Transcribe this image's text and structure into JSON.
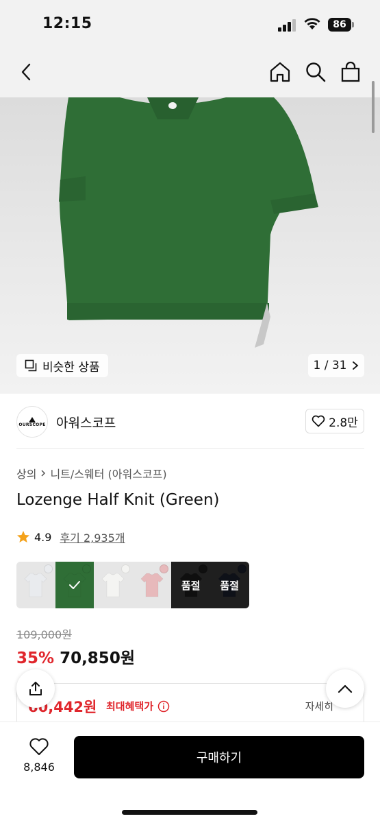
{
  "status": {
    "time": "12:15",
    "battery": "86"
  },
  "nav": {
    "back_icon": "chevron-left-icon",
    "home_icon": "home-icon",
    "search_icon": "search-icon",
    "bag_icon": "shopping-bag-icon"
  },
  "gallery": {
    "similar_label": "비슷한 상품",
    "page_indicator": "1 / 31",
    "product_color": "#2f6e36"
  },
  "brand": {
    "logo_text": "OURSCOPE",
    "name": "아워스코프",
    "likes": "2.8만"
  },
  "breadcrumb": {
    "category": "상의",
    "sub": "니트/스웨터 (아워스코프)"
  },
  "product": {
    "title": "Lozenge Half Knit (Green)"
  },
  "rating": {
    "score": "4.9",
    "reviews": "후기 2,935개"
  },
  "swatches": [
    {
      "color": "#e9ebee",
      "sold_out": false,
      "selected": false
    },
    {
      "color": "#2f6e36",
      "sold_out": false,
      "selected": true
    },
    {
      "color": "#f4f4f2",
      "sold_out": false,
      "selected": false
    },
    {
      "color": "#e7b9bb",
      "sold_out": false,
      "selected": false
    },
    {
      "color": "#1c1c1c",
      "sold_out": true,
      "selected": false,
      "label": "품절"
    },
    {
      "color": "#1a1f2c",
      "sold_out": true,
      "selected": false,
      "label": "품절"
    }
  ],
  "pricing": {
    "original": "109,000원",
    "discount": "35%",
    "sale": "70,850원"
  },
  "benefit": {
    "price": "60,442원",
    "label": "최대혜택가",
    "detail": "자세히"
  },
  "bottom": {
    "wish_count": "8,846",
    "buy_label": "구매하기"
  },
  "colors": {
    "accent_red": "#e0262c",
    "buy_button": "#000000",
    "star": "#f4a21b"
  }
}
